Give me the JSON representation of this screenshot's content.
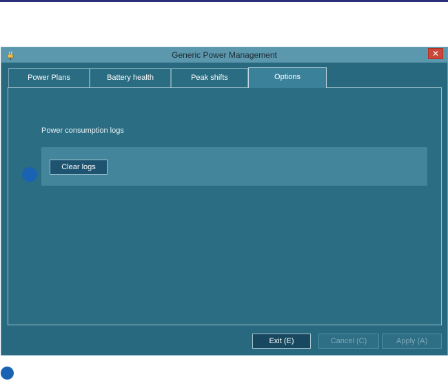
{
  "window": {
    "title": "Generic Power Management",
    "close_label": "✕"
  },
  "tabs": [
    {
      "label": "Power Plans"
    },
    {
      "label": "Battery health"
    },
    {
      "label": "Peak shifts"
    },
    {
      "label": "Options",
      "active": true
    }
  ],
  "options": {
    "section_label": "Power consumption logs",
    "clear_logs_label": "Clear logs"
  },
  "footer": {
    "exit_label": "Exit (E)",
    "cancel_label": "Cancel (C)",
    "apply_label": "Apply (A)"
  },
  "colors": {
    "window_bg": "#29697f",
    "titlebar": "#5c98ad",
    "close_button": "#c9473b",
    "marker": "#1a63b2",
    "top_rule": "#2c2f7a"
  },
  "icons": {
    "app": "power-plug-icon",
    "close": "close-icon"
  }
}
